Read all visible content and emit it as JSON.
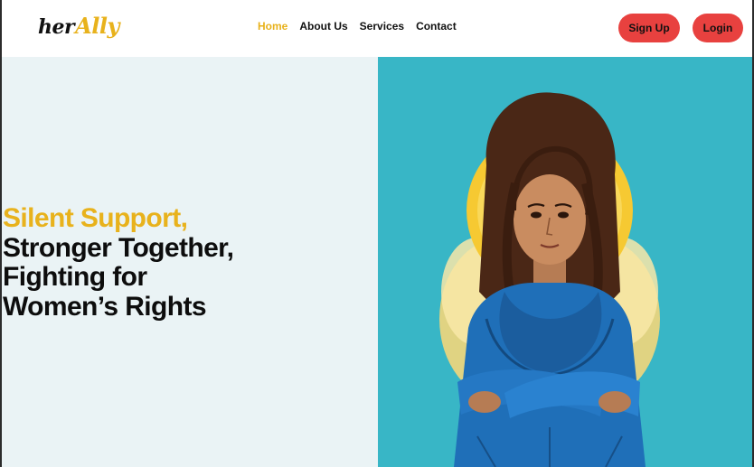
{
  "brand": {
    "logo_part1": "her",
    "logo_part2": "Ally",
    "accent_color": "#e8b21c",
    "button_color": "#e8413f"
  },
  "nav": {
    "items": [
      {
        "label": "Home",
        "active": true
      },
      {
        "label": "About Us",
        "active": false
      },
      {
        "label": "Services",
        "active": false
      },
      {
        "label": "Contact",
        "active": false
      }
    ]
  },
  "actions": {
    "signup_label": "Sign Up",
    "login_label": "Login"
  },
  "hero": {
    "headline_accent": "Silent Support,",
    "headline_lines": [
      "Stronger Together,",
      "Fighting for",
      "Women’s Rights"
    ],
    "left_bg": "#eaf3f5",
    "right_bg": "#38b6c6",
    "image_subject": "illustration of a woman with crossed arms in a blue kurta and dupatta before a golden halo"
  }
}
